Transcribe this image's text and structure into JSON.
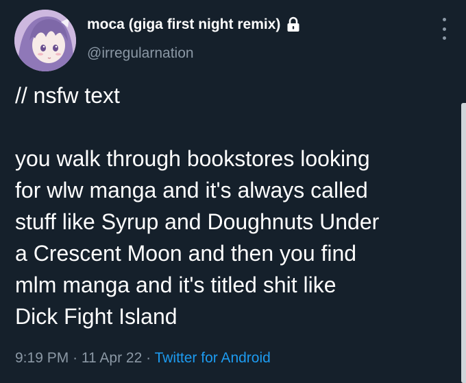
{
  "user": {
    "display_name": "moca (giga first night remix)",
    "handle": "@irregularnation",
    "protected_icon": "lock-icon",
    "avatar_icon": "anime-girl-avatar"
  },
  "tweet": {
    "lines_part1": [
      "// nsfw text"
    ],
    "lines_part2": [
      "you walk through bookstores looking",
      "for wlw manga and it's always called",
      "stuff like Syrup and Doughnuts Under",
      "a Crescent Moon and then you find",
      "mlm manga and it's titled shit like",
      "Dick Fight Island"
    ]
  },
  "meta": {
    "time": "9:19 PM",
    "separator": "·",
    "date": "11 Apr 22",
    "source": "Twitter for Android"
  },
  "colors": {
    "background": "#15202b",
    "text": "#ffffff",
    "secondary": "#8b98a5",
    "link": "#1d9bf0"
  }
}
